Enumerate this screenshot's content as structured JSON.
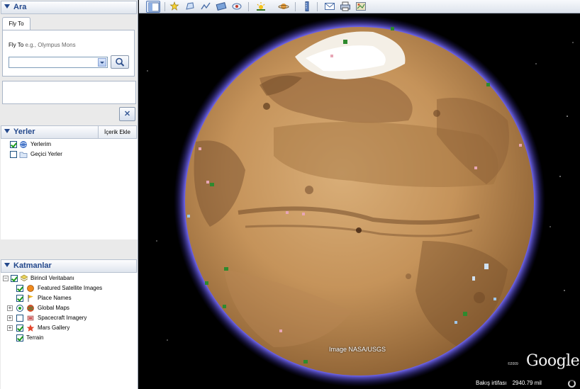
{
  "search": {
    "title": "Ara",
    "tab_label": "Fly To",
    "hint_label": "Fly To",
    "hint_example": "e.g., Olympus Mons",
    "input_value": ""
  },
  "places": {
    "title": "Yerler",
    "add_content_label": "İçerik Ekle",
    "items": [
      {
        "label": "Yerlerim",
        "checked": true,
        "icon": "globe-icon"
      },
      {
        "label": "Geçici Yerler",
        "checked": false,
        "icon": "folder-icon"
      }
    ]
  },
  "layers": {
    "title": "Katmanlar",
    "items": [
      {
        "label": "Birincil Veritabanı",
        "checked": true,
        "icon": "layers-stack-icon"
      },
      {
        "label": "Featured Satellite Images",
        "checked": true,
        "icon": "satellite-orange-icon"
      },
      {
        "label": "Place Names",
        "checked": true,
        "icon": "flag-icon"
      },
      {
        "label": "Global Maps",
        "checked": true,
        "icon": "planet-icon"
      },
      {
        "label": "Spacecraft Imagery",
        "checked": false,
        "icon": "spacecraft-icon"
      },
      {
        "label": "Mars Gallery",
        "checked": true,
        "icon": "star-icon"
      },
      {
        "label": "Terrain",
        "checked": true,
        "icon": ""
      }
    ]
  },
  "toolbar": {
    "buttons": [
      "hide-sidebar-icon",
      "placemark-icon",
      "polygon-icon",
      "path-icon",
      "image-overlay-icon",
      "record-tour-icon",
      "sunlight-icon",
      "planets-icon",
      "ruler-icon",
      "email-icon",
      "print-icon",
      "view-in-maps-icon"
    ]
  },
  "view": {
    "image_credit": "Image NASA/USGS",
    "logo_copyright": "©2009",
    "logo_text": "Google",
    "altitude_label": "Bakış irtifası",
    "altitude_value": "2940.79 mil"
  },
  "colors": {
    "accent": "#23488c",
    "atmosphere": "#5a4fd6",
    "planet_surface": "#c79a62"
  }
}
